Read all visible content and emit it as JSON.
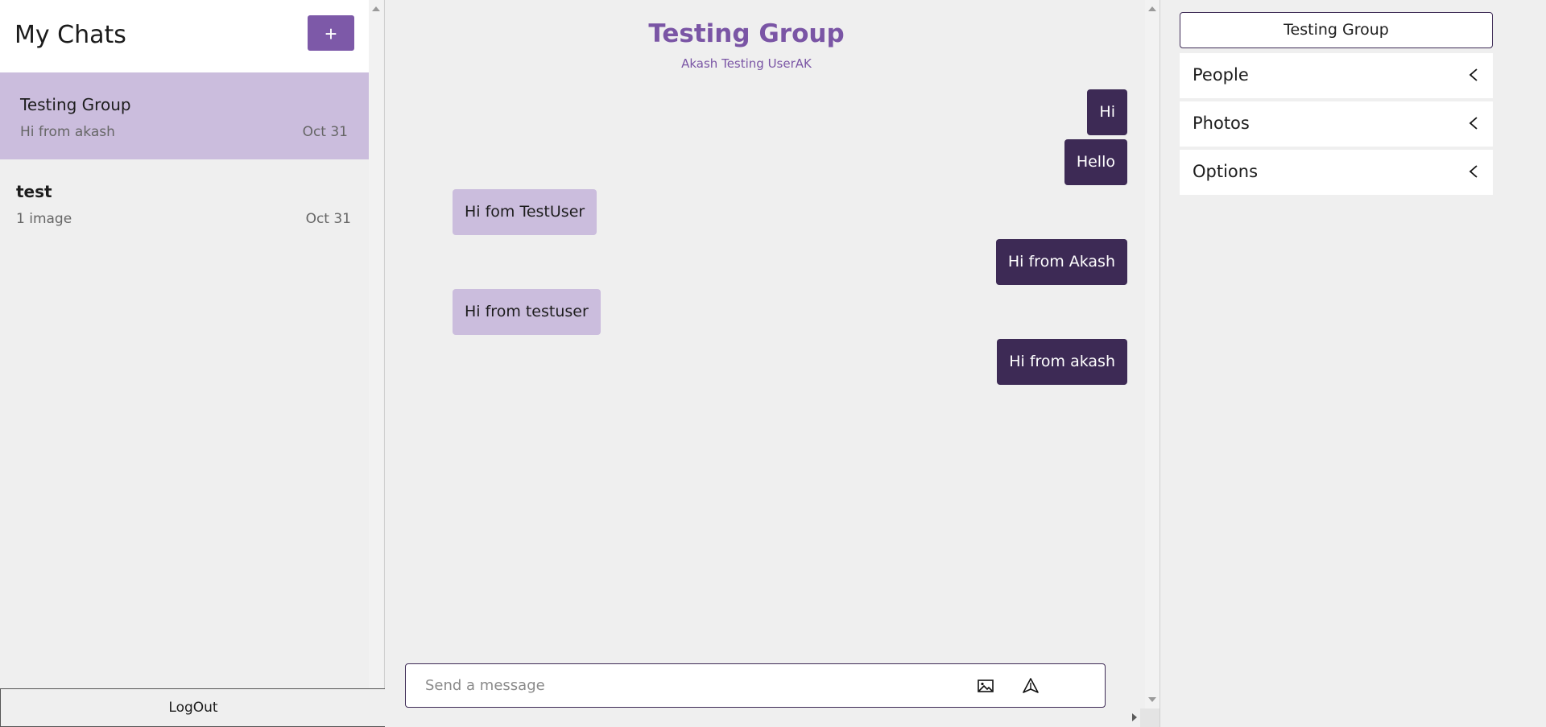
{
  "sidebar": {
    "title": "My Chats",
    "new_chat_label": "+",
    "chats": [
      {
        "name": "Testing Group",
        "preview": "Hi from akash",
        "date": "Oct 31"
      },
      {
        "name": "test",
        "preview": "1 image",
        "date": "Oct 31"
      }
    ],
    "logout_label": "LogOut"
  },
  "chat": {
    "title": "Testing Group",
    "members": "Akash Testing UserAK",
    "messages": [
      {
        "text": "Hi",
        "direction": "out"
      },
      {
        "text": "Hello",
        "direction": "out"
      },
      {
        "text": "Hi fom TestUser",
        "direction": "in"
      },
      {
        "text": "Hi from Akash",
        "direction": "out"
      },
      {
        "text": "Hi from testuser",
        "direction": "in"
      },
      {
        "text": "Hi from akash",
        "direction": "out"
      }
    ],
    "composer": {
      "placeholder": "Send a message",
      "image_icon": "image-icon",
      "send_icon": "send-icon"
    }
  },
  "details": {
    "title": "Testing Group",
    "sections": [
      {
        "label": "People",
        "icon": "chevron-left-icon"
      },
      {
        "label": "Photos",
        "icon": "chevron-left-icon"
      },
      {
        "label": "Options",
        "icon": "chevron-left-icon"
      }
    ]
  },
  "colors": {
    "accent": "#7d59a8",
    "outgoing_bubble": "#3d2a55",
    "incoming_bubble": "#cbbddd",
    "background": "#efefef"
  }
}
